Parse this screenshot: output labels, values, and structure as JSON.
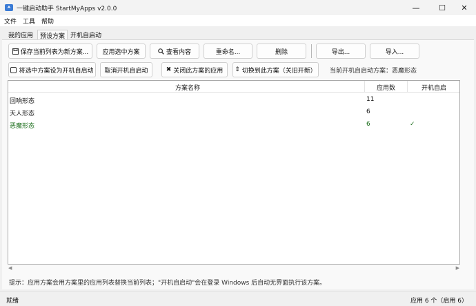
{
  "window": {
    "title": "一键启动助手 StartMyApps v2.0.0",
    "minimize_glyph": "—",
    "maximize_glyph": "☐",
    "close_glyph": "✕"
  },
  "menu": [
    "文件",
    "工具",
    "帮助"
  ],
  "tabs": [
    {
      "label": "我的应用",
      "active": false
    },
    {
      "label": "预设方案",
      "active": true
    },
    {
      "label": "开机自启动",
      "active": false
    }
  ],
  "toolbar": {
    "save_as_new": "保存当前列表为新方案...",
    "apply_selected": "应用选中方案",
    "view_content": "查看内容",
    "rename": "重命名...",
    "delete": "删除",
    "export": "导出...",
    "import": "导入...",
    "set_autostart": "将选中方案设为开机自启动",
    "cancel_autostart": "取消开机自启动",
    "close_apps": "关闭此方案的应用",
    "switch_scheme": "切换到此方案（关旧开新）",
    "current_autostart": "当前开机自启动方案：恶魔形态"
  },
  "table": {
    "headers": {
      "name": "方案名称",
      "count": "应用数",
      "autostart": "开机自启"
    },
    "rows": [
      {
        "name": "回响形态",
        "count": "11",
        "autostart": ""
      },
      {
        "name": "天人形态",
        "count": "6",
        "autostart": ""
      },
      {
        "name": "恶魔形态",
        "count": "6",
        "autostart": "✓"
      }
    ]
  },
  "hint": "提示：应用方案会用方案里的应用列表替换当前列表；\"开机自启动\"会在登录 Windows 后自动无界面执行该方案。",
  "status": {
    "left": "就绪",
    "right": "应用 6 个（启用 6）"
  },
  "colors": {
    "active_row_text": "#1e6f1e",
    "title_bar": "#f3f3f3"
  }
}
